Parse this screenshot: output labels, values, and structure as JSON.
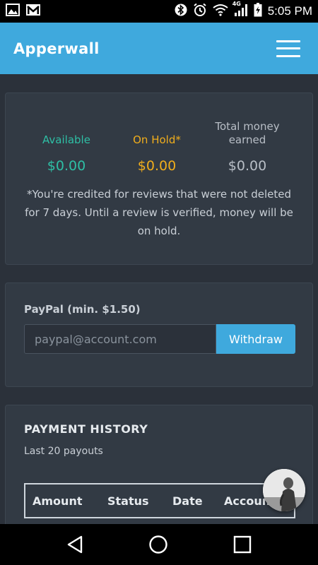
{
  "status_bar": {
    "time": "5:05 PM",
    "network_badge": "4G",
    "left_icons": [
      "image-icon",
      "gmail-icon"
    ],
    "right_icons": [
      "bluetooth-icon",
      "alarm-icon",
      "wifi-icon",
      "signal-icon",
      "battery-icon"
    ]
  },
  "header": {
    "title": "Apperwall",
    "menu_icon": "hamburger-menu-icon"
  },
  "balance": {
    "available_label": "Available",
    "available_value": "$0.00",
    "on_hold_label": "On Hold*",
    "on_hold_value": "$0.00",
    "total_label_line1": "Total money",
    "total_label_line2": "earned",
    "total_value": "$0.00",
    "note": "*You're credited for reviews that were not deleted for 7 days. Until a review is verified, money will be on hold.",
    "colors": {
      "available": "#2ebfa5",
      "on_hold": "#f0ad1c",
      "total": "#b8bec6"
    }
  },
  "paypal": {
    "label": "PayPal (min. $1.50)",
    "input_value": "",
    "input_placeholder": "paypal@account.com",
    "withdraw_label": "Withdraw"
  },
  "history": {
    "title": "PAYMENT HISTORY",
    "subtitle": "Last 20 payouts",
    "columns": [
      "Amount",
      "Status",
      "Date",
      "Account"
    ]
  },
  "nav": {
    "back_icon": "back-triangle-icon",
    "home_icon": "home-circle-icon",
    "recents_icon": "recents-square-icon"
  },
  "accent": "#3fa9dd"
}
